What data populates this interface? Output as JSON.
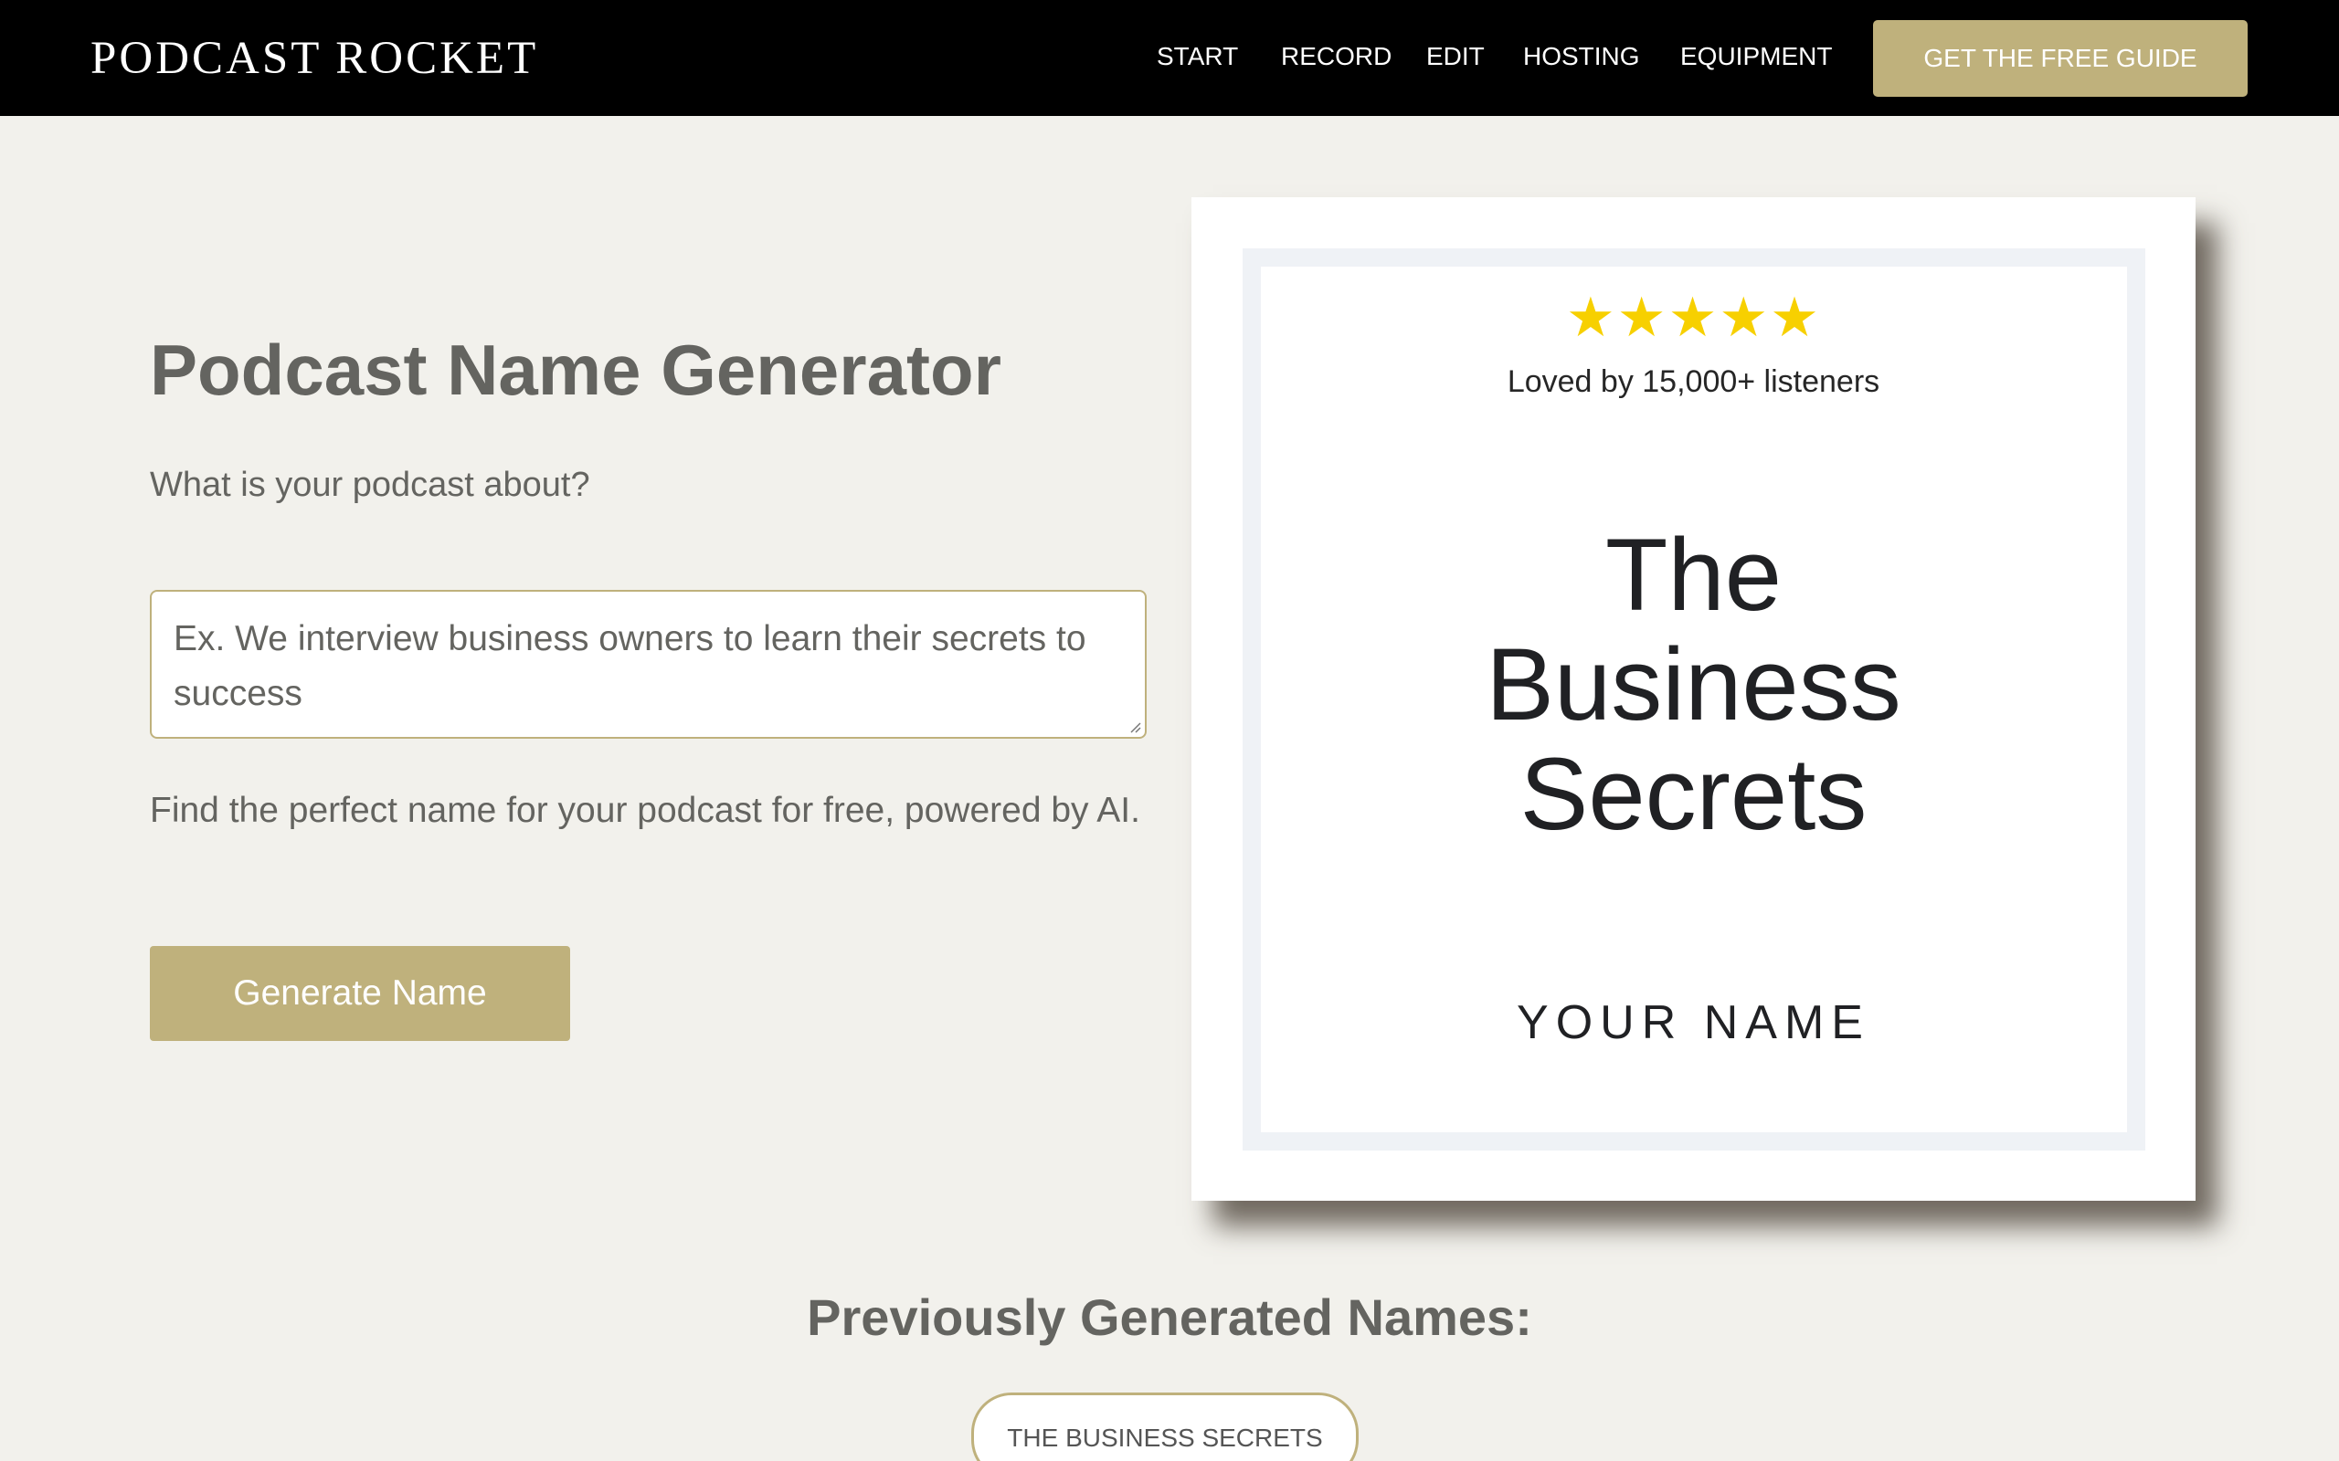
{
  "header": {
    "brand": "PODCAST ROCKET",
    "nav": [
      {
        "label": "START"
      },
      {
        "label": "RECORD"
      },
      {
        "label": "EDIT"
      },
      {
        "label": "HOSTING"
      },
      {
        "label": "EQUIPMENT"
      }
    ],
    "cta_label": "GET THE FREE GUIDE"
  },
  "generator": {
    "title": "Podcast Name Generator",
    "question": "What is your podcast about?",
    "input_placeholder": "Ex. We interview business owners to learn their secrets to success",
    "input_value": "",
    "tagline": "Find the perfect name for your podcast for free, powered by AI.",
    "button_label": "Generate Name"
  },
  "cover": {
    "stars": "★★★★★",
    "rating": 5,
    "loved_text": "Loved by 15,000+ listeners",
    "title_lines": [
      "The",
      "Business",
      "Secrets"
    ],
    "author": "YOUR NAME"
  },
  "history": {
    "title": "Previously Generated Names:",
    "items": [
      {
        "label": "THE BUSINESS SECRETS"
      }
    ]
  },
  "colors": {
    "header_bg": "#000000",
    "page_bg": "#f2f1ec",
    "accent": "#bfb17c",
    "text_gray": "#646460",
    "star": "#f7d000"
  }
}
